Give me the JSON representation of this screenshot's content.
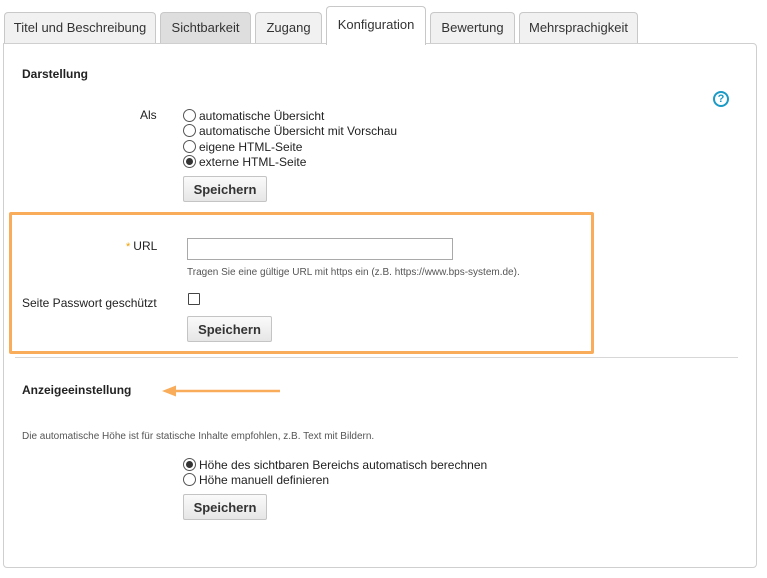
{
  "tabs": [
    {
      "label": "Titel und Beschreibung"
    },
    {
      "label": "Sichtbarkeit"
    },
    {
      "label": "Zugang"
    },
    {
      "label": "Konfiguration"
    },
    {
      "label": "Bewertung"
    },
    {
      "label": "Mehrsprachigkeit"
    }
  ],
  "active_tab": "Konfiguration",
  "darstellung": {
    "heading": "Darstellung",
    "als_label": "Als",
    "options": [
      {
        "label": "automatische Übersicht",
        "selected": false
      },
      {
        "label": "automatische Übersicht mit Vorschau",
        "selected": false
      },
      {
        "label": "eigene HTML-Seite",
        "selected": false
      },
      {
        "label": "externe HTML-Seite",
        "selected": true
      }
    ],
    "save_label": "Speichern"
  },
  "url_section": {
    "required_mark": "*",
    "url_label": "URL",
    "url_value": "",
    "url_hint": "Tragen Sie eine gültige URL mit https ein (z.B. https://www.bps-system.de).",
    "password_label": "Seite Passwort geschützt",
    "password_checked": false,
    "save_label": "Speichern"
  },
  "anzeige": {
    "heading": "Anzeigeeinstellung",
    "description": "Die automatische Höhe ist für statische Inhalte empfohlen, z.B. Text mit Bildern.",
    "options": [
      {
        "label": "Höhe des sichtbaren Bereichs automatisch berechnen",
        "selected": true
      },
      {
        "label": "Höhe manuell definieren",
        "selected": false
      }
    ],
    "save_label": "Speichern"
  },
  "help_icon": "?",
  "colors": {
    "highlight": "#f9ac5a",
    "help": "#1a9ac5"
  }
}
